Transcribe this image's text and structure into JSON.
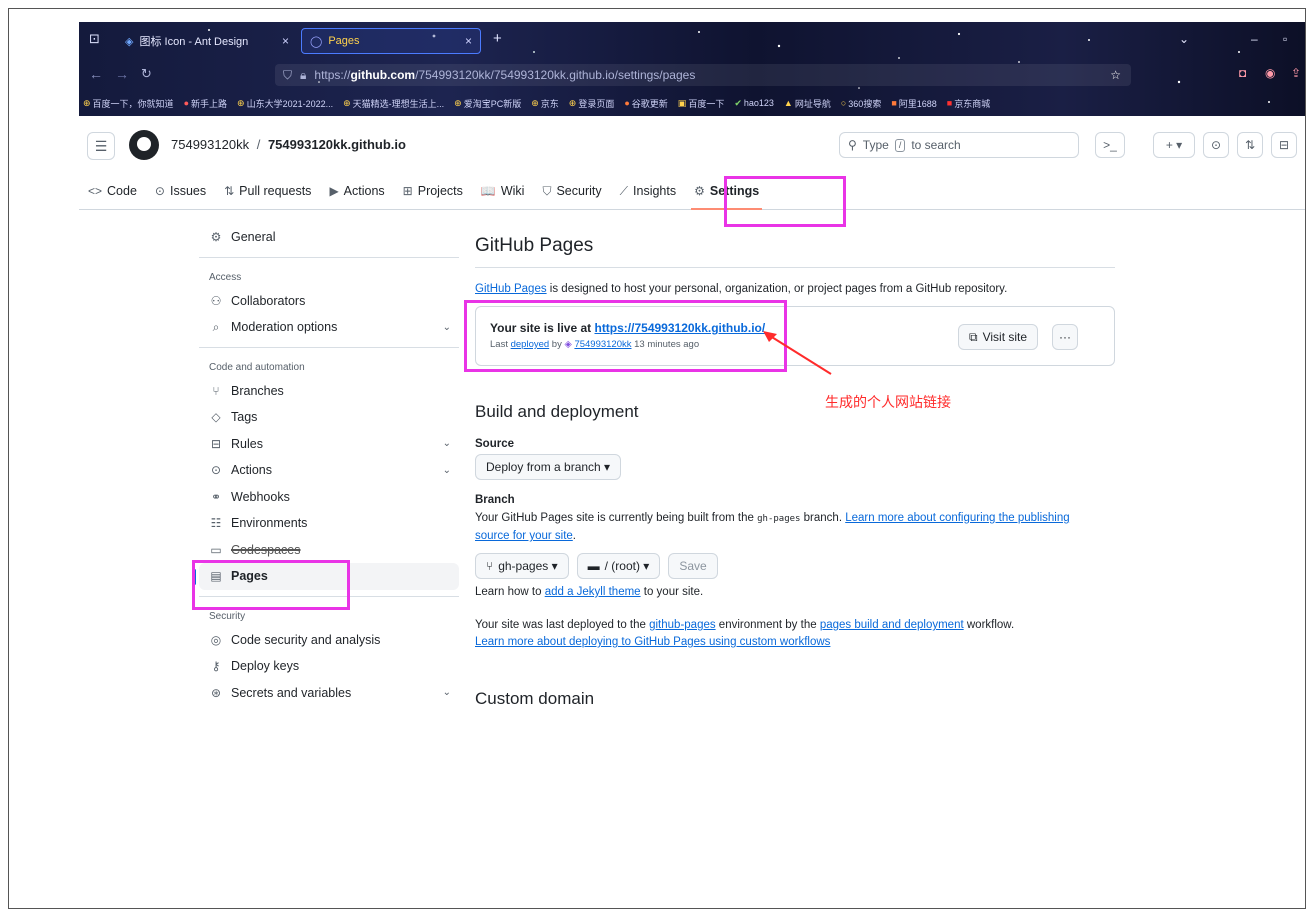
{
  "browser": {
    "tabs": [
      {
        "label": "图标 Icon - Ant Design",
        "close": "×"
      },
      {
        "label": "Pages",
        "close": "×"
      }
    ],
    "new_tab": "+",
    "window_controls": {
      "dropdown": "⌄",
      "minimize": "–",
      "maximize": "▫"
    },
    "url_prefix": "https://",
    "url_host": "github.com",
    "url_path": "/754993120kk/754993120kk.github.io/settings/pages",
    "bookmarks": [
      "百度一下，你就知道",
      "新手上路",
      "山东大学2021-2022...",
      "天猫精选-理想生活上...",
      "爱淘宝PC新版",
      "京东",
      "登录页面",
      "谷歌更新",
      "百度一下",
      "hao123",
      "网址导航",
      "360搜索",
      "阿里1688",
      "京东商城"
    ]
  },
  "header": {
    "owner": "754993120kk",
    "separator": "/",
    "repo": "754993120kk.github.io",
    "search_placeholder_pre": "Type",
    "search_key": "/",
    "search_placeholder_post": "to search",
    "cmd_label": ">_",
    "plus_label": "+ ▾"
  },
  "repo_nav": [
    {
      "label": "Code",
      "icon": "<>"
    },
    {
      "label": "Issues",
      "icon": "⊙"
    },
    {
      "label": "Pull requests",
      "icon": "⇅"
    },
    {
      "label": "Actions",
      "icon": "▶"
    },
    {
      "label": "Projects",
      "icon": "⊞"
    },
    {
      "label": "Wiki",
      "icon": "📖"
    },
    {
      "label": "Security",
      "icon": "⛉"
    },
    {
      "label": "Insights",
      "icon": "⟋"
    },
    {
      "label": "Settings",
      "icon": "⚙"
    }
  ],
  "sidebar": {
    "general": "General",
    "access_heading": "Access",
    "collaborators": "Collaborators",
    "moderation": "Moderation options",
    "code_heading": "Code and automation",
    "branches": "Branches",
    "tags": "Tags",
    "rules": "Rules",
    "actions": "Actions",
    "webhooks": "Webhooks",
    "environments": "Environments",
    "codespaces": "Codespaces",
    "pages": "Pages",
    "security_heading": "Security",
    "code_security": "Code security and analysis",
    "deploy_keys": "Deploy keys",
    "secrets": "Secrets and variables"
  },
  "main": {
    "title": "GitHub Pages",
    "intro_link": "GitHub Pages",
    "intro_rest": " is designed to host your personal, organization, or project pages from a GitHub repository.",
    "live_prefix": "Your site is live at ",
    "live_url": "https://754993120kk.github.io/",
    "last_prefix": "Last ",
    "last_deployed": "deployed",
    "last_by": " by ",
    "last_user": "754993120kk",
    "last_time": " 13 minutes ago",
    "visit_site": "Visit site",
    "more": "···",
    "annotation": "生成的个人网站链接",
    "build_title": "Build and deployment",
    "source_label": "Source",
    "source_value": "Deploy from a branch ▾",
    "branch_label": "Branch",
    "branch_text1": "Your GitHub Pages site is currently being built from the ",
    "branch_code": "gh-pages",
    "branch_text2": " branch. ",
    "branch_link": "Learn more about configuring the publishing source for your site",
    "branch_dot": ".",
    "branch_select": "gh-pages ▾",
    "folder_select": "/ (root) ▾",
    "save": "Save",
    "jekyll_pre": "Learn how to ",
    "jekyll_link": "add a Jekyll theme",
    "jekyll_post": " to your site.",
    "deployed_pre": "Your site was last deployed to the ",
    "deployed_env": "github-pages",
    "deployed_mid": " environment by the ",
    "deployed_wf": "pages build and deployment",
    "deployed_post": " workflow.",
    "custom_wf_link": "Learn more about deploying to GitHub Pages using custom workflows",
    "custom_domain": "Custom domain"
  },
  "colors": {
    "highlight": "#e934e6",
    "annotation": "#ff2b2b",
    "link": "#0969da",
    "accent_underline": "#fd8c73"
  }
}
